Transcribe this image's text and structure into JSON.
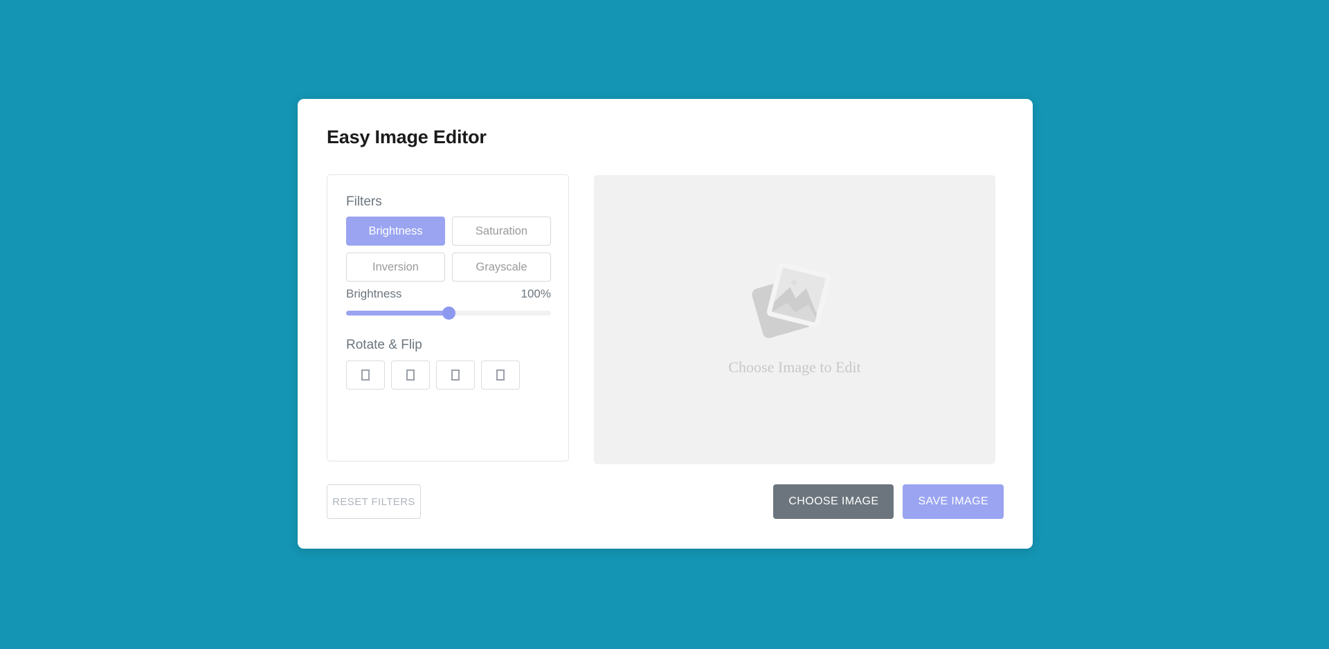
{
  "theme": {
    "page_background": "#1495b3",
    "card_background": "#ffffff",
    "accent": "#9aa4f0",
    "muted_text": "#6c757d",
    "preview_background": "#f1f1f1"
  },
  "app": {
    "title": "Easy Image Editor"
  },
  "filters": {
    "heading": "Filters",
    "options": [
      {
        "label": "Brightness",
        "active": true
      },
      {
        "label": "Saturation",
        "active": false
      },
      {
        "label": "Inversion",
        "active": false
      },
      {
        "label": "Grayscale",
        "active": false
      }
    ],
    "slider": {
      "label": "Brightness",
      "value_text": "100%",
      "value": 100,
      "min": 0,
      "max": 200,
      "fill_percent": 50
    }
  },
  "rotate_flip": {
    "heading": "Rotate & Flip",
    "buttons": [
      {
        "icon": "rotate-left-icon",
        "glyph": "□"
      },
      {
        "icon": "rotate-right-icon",
        "glyph": "□"
      },
      {
        "icon": "flip-horizontal-icon",
        "glyph": "□"
      },
      {
        "icon": "flip-vertical-icon",
        "glyph": "□"
      }
    ]
  },
  "preview": {
    "placeholder_text": "Choose Image to Edit",
    "placeholder_icon": "gallery-photos-icon"
  },
  "controls": {
    "reset_label": "RESET FILTERS",
    "choose_label": "CHOOSE IMAGE",
    "save_label": "SAVE IMAGE"
  }
}
